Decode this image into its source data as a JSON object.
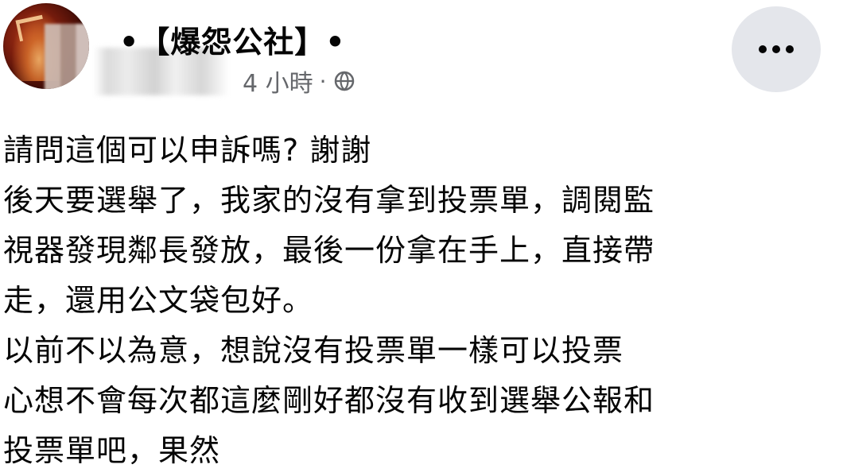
{
  "post": {
    "group_name": "•【爆怨公社】•",
    "timestamp": "4 小時",
    "separator": "·",
    "privacy_icon": "globe-icon",
    "more_icon": "more-horizontal-icon",
    "lines": [
      "請問這個可以申訴嗎? 謝謝",
      "後天要選舉了，我家的沒有拿到投票單，調閱監",
      "視器發現鄰長發放，最後一份拿在手上，直接帶",
      "走，還用公文袋包好。",
      "以前不以為意，想說沒有投票單一樣可以投票",
      "心想不會每次都這麼剛好都沒有收到選舉公報和",
      "投票單吧，果然"
    ]
  },
  "colors": {
    "text": "#050505",
    "meta": "#65676b",
    "button_bg": "#e4e6eb"
  }
}
